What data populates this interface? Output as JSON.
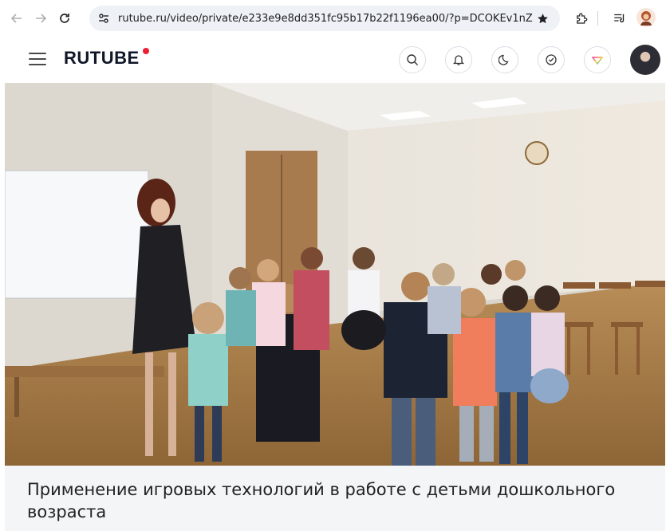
{
  "browser": {
    "url": "rutube.ru/video/private/e233e9e8dd351fc95b17b22f1196ea00/?p=DCOKEv1nZdPhh4hhr..."
  },
  "header": {
    "logo_text": "RUTUBE",
    "buttons": [
      "search-icon",
      "bell-icon",
      "moon-icon",
      "shield-check-icon",
      "diamond-icon"
    ]
  },
  "video": {
    "title": "Применение игровых технологий в работе с детьми дошкольного возраста"
  },
  "colors": {
    "logo_accent": "#ed1f34",
    "title_bar_bg": "#f4f5f7"
  }
}
